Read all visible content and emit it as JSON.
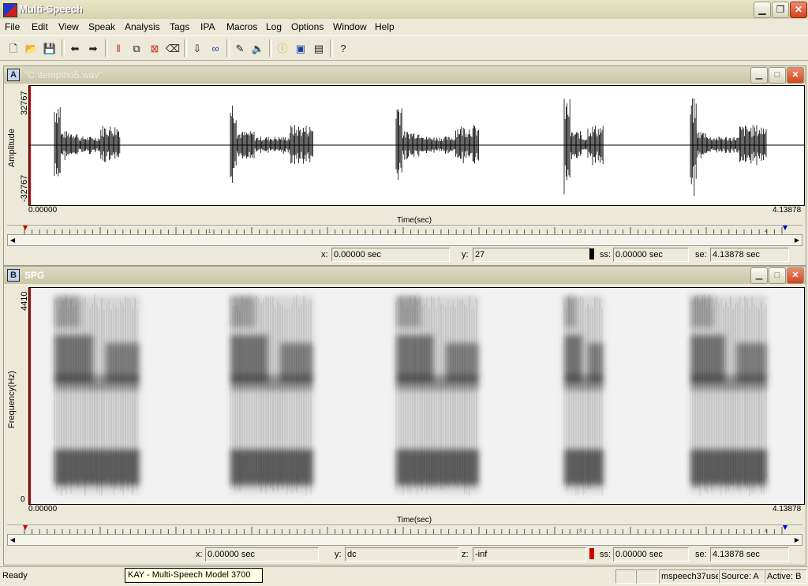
{
  "window": {
    "title": "Multi-Speech"
  },
  "menu": [
    "File",
    "Edit",
    "View",
    "Speak",
    "Analysis",
    "Tags",
    "IPA",
    "Macros",
    "Log",
    "Options",
    "Window",
    "Help"
  ],
  "toolbar": {
    "icons": [
      "new-icon",
      "open-icon",
      "save-icon",
      "back-arrow-icon",
      "forward-arrow-icon",
      "spectrogram-icon",
      "copy-icon",
      "delete-icon",
      "erase-icon",
      "download-icon",
      "link-icon",
      "microphone-icon",
      "speaker-icon",
      "info-icon",
      "window-icon",
      "grid-icon",
      "help-icon"
    ]
  },
  "panelA": {
    "letter": "A",
    "title": "\"C:\\temp\\ho5.wav\"",
    "y_top": "32767",
    "y_bottom": "-32767",
    "y_label": "Amplitude",
    "x_start": "0.00000",
    "x_end": "4.13878",
    "x_label": "Time(sec)",
    "ruler_ticks": [
      "1",
      "2",
      "3",
      "4"
    ],
    "status": {
      "x_label": "x:",
      "x_value": "0.00000 sec",
      "y_label": "y:",
      "y_value": "27",
      "ss_label": "ss:",
      "ss_value": "0.00000 sec",
      "se_label": "se:",
      "se_value": "4.13878 sec"
    }
  },
  "panelB": {
    "letter": "B",
    "title": "SPG",
    "y_top": "4410",
    "y_bottom": "0",
    "y_label": "Frequency(Hz)",
    "x_start": "0.00000",
    "x_end": "4.13878",
    "x_label": "Time(sec)",
    "ruler_ticks": [
      "1",
      "2",
      "3",
      "4"
    ],
    "status": {
      "x_label": "x:",
      "x_value": "0.00000 sec",
      "y_label": "y:",
      "y_value": "dc",
      "z_label": "z:",
      "z_value": "-inf",
      "ss_label": "ss:",
      "ss_value": "0.00000 sec",
      "se_label": "se:",
      "se_value": "4.13878 sec"
    }
  },
  "statusbar": {
    "ready": "Ready",
    "tooltip": "KAY - Multi-Speech Model 3700",
    "user": "mspeech37use",
    "source": "Source: A",
    "active": "Active: B"
  },
  "colors": {
    "marker_start": "#cc0000",
    "marker_end": "#0000cc",
    "waveform": "#000000"
  }
}
